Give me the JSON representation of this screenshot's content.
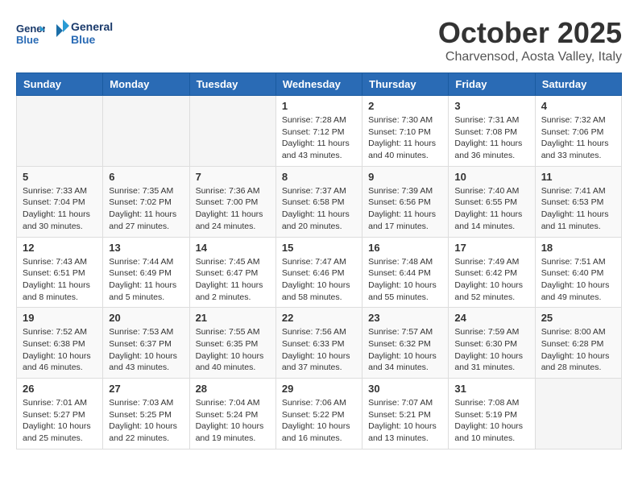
{
  "header": {
    "logo_line1": "General",
    "logo_line2": "Blue",
    "month": "October 2025",
    "location": "Charvensod, Aosta Valley, Italy"
  },
  "days_of_week": [
    "Sunday",
    "Monday",
    "Tuesday",
    "Wednesday",
    "Thursday",
    "Friday",
    "Saturday"
  ],
  "weeks": [
    [
      {
        "day": "",
        "content": ""
      },
      {
        "day": "",
        "content": ""
      },
      {
        "day": "",
        "content": ""
      },
      {
        "day": "1",
        "content": "Sunrise: 7:28 AM\nSunset: 7:12 PM\nDaylight: 11 hours and 43 minutes."
      },
      {
        "day": "2",
        "content": "Sunrise: 7:30 AM\nSunset: 7:10 PM\nDaylight: 11 hours and 40 minutes."
      },
      {
        "day": "3",
        "content": "Sunrise: 7:31 AM\nSunset: 7:08 PM\nDaylight: 11 hours and 36 minutes."
      },
      {
        "day": "4",
        "content": "Sunrise: 7:32 AM\nSunset: 7:06 PM\nDaylight: 11 hours and 33 minutes."
      }
    ],
    [
      {
        "day": "5",
        "content": "Sunrise: 7:33 AM\nSunset: 7:04 PM\nDaylight: 11 hours and 30 minutes."
      },
      {
        "day": "6",
        "content": "Sunrise: 7:35 AM\nSunset: 7:02 PM\nDaylight: 11 hours and 27 minutes."
      },
      {
        "day": "7",
        "content": "Sunrise: 7:36 AM\nSunset: 7:00 PM\nDaylight: 11 hours and 24 minutes."
      },
      {
        "day": "8",
        "content": "Sunrise: 7:37 AM\nSunset: 6:58 PM\nDaylight: 11 hours and 20 minutes."
      },
      {
        "day": "9",
        "content": "Sunrise: 7:39 AM\nSunset: 6:56 PM\nDaylight: 11 hours and 17 minutes."
      },
      {
        "day": "10",
        "content": "Sunrise: 7:40 AM\nSunset: 6:55 PM\nDaylight: 11 hours and 14 minutes."
      },
      {
        "day": "11",
        "content": "Sunrise: 7:41 AM\nSunset: 6:53 PM\nDaylight: 11 hours and 11 minutes."
      }
    ],
    [
      {
        "day": "12",
        "content": "Sunrise: 7:43 AM\nSunset: 6:51 PM\nDaylight: 11 hours and 8 minutes."
      },
      {
        "day": "13",
        "content": "Sunrise: 7:44 AM\nSunset: 6:49 PM\nDaylight: 11 hours and 5 minutes."
      },
      {
        "day": "14",
        "content": "Sunrise: 7:45 AM\nSunset: 6:47 PM\nDaylight: 11 hours and 2 minutes."
      },
      {
        "day": "15",
        "content": "Sunrise: 7:47 AM\nSunset: 6:46 PM\nDaylight: 10 hours and 58 minutes."
      },
      {
        "day": "16",
        "content": "Sunrise: 7:48 AM\nSunset: 6:44 PM\nDaylight: 10 hours and 55 minutes."
      },
      {
        "day": "17",
        "content": "Sunrise: 7:49 AM\nSunset: 6:42 PM\nDaylight: 10 hours and 52 minutes."
      },
      {
        "day": "18",
        "content": "Sunrise: 7:51 AM\nSunset: 6:40 PM\nDaylight: 10 hours and 49 minutes."
      }
    ],
    [
      {
        "day": "19",
        "content": "Sunrise: 7:52 AM\nSunset: 6:38 PM\nDaylight: 10 hours and 46 minutes."
      },
      {
        "day": "20",
        "content": "Sunrise: 7:53 AM\nSunset: 6:37 PM\nDaylight: 10 hours and 43 minutes."
      },
      {
        "day": "21",
        "content": "Sunrise: 7:55 AM\nSunset: 6:35 PM\nDaylight: 10 hours and 40 minutes."
      },
      {
        "day": "22",
        "content": "Sunrise: 7:56 AM\nSunset: 6:33 PM\nDaylight: 10 hours and 37 minutes."
      },
      {
        "day": "23",
        "content": "Sunrise: 7:57 AM\nSunset: 6:32 PM\nDaylight: 10 hours and 34 minutes."
      },
      {
        "day": "24",
        "content": "Sunrise: 7:59 AM\nSunset: 6:30 PM\nDaylight: 10 hours and 31 minutes."
      },
      {
        "day": "25",
        "content": "Sunrise: 8:00 AM\nSunset: 6:28 PM\nDaylight: 10 hours and 28 minutes."
      }
    ],
    [
      {
        "day": "26",
        "content": "Sunrise: 7:01 AM\nSunset: 5:27 PM\nDaylight: 10 hours and 25 minutes."
      },
      {
        "day": "27",
        "content": "Sunrise: 7:03 AM\nSunset: 5:25 PM\nDaylight: 10 hours and 22 minutes."
      },
      {
        "day": "28",
        "content": "Sunrise: 7:04 AM\nSunset: 5:24 PM\nDaylight: 10 hours and 19 minutes."
      },
      {
        "day": "29",
        "content": "Sunrise: 7:06 AM\nSunset: 5:22 PM\nDaylight: 10 hours and 16 minutes."
      },
      {
        "day": "30",
        "content": "Sunrise: 7:07 AM\nSunset: 5:21 PM\nDaylight: 10 hours and 13 minutes."
      },
      {
        "day": "31",
        "content": "Sunrise: 7:08 AM\nSunset: 5:19 PM\nDaylight: 10 hours and 10 minutes."
      },
      {
        "day": "",
        "content": ""
      }
    ]
  ]
}
